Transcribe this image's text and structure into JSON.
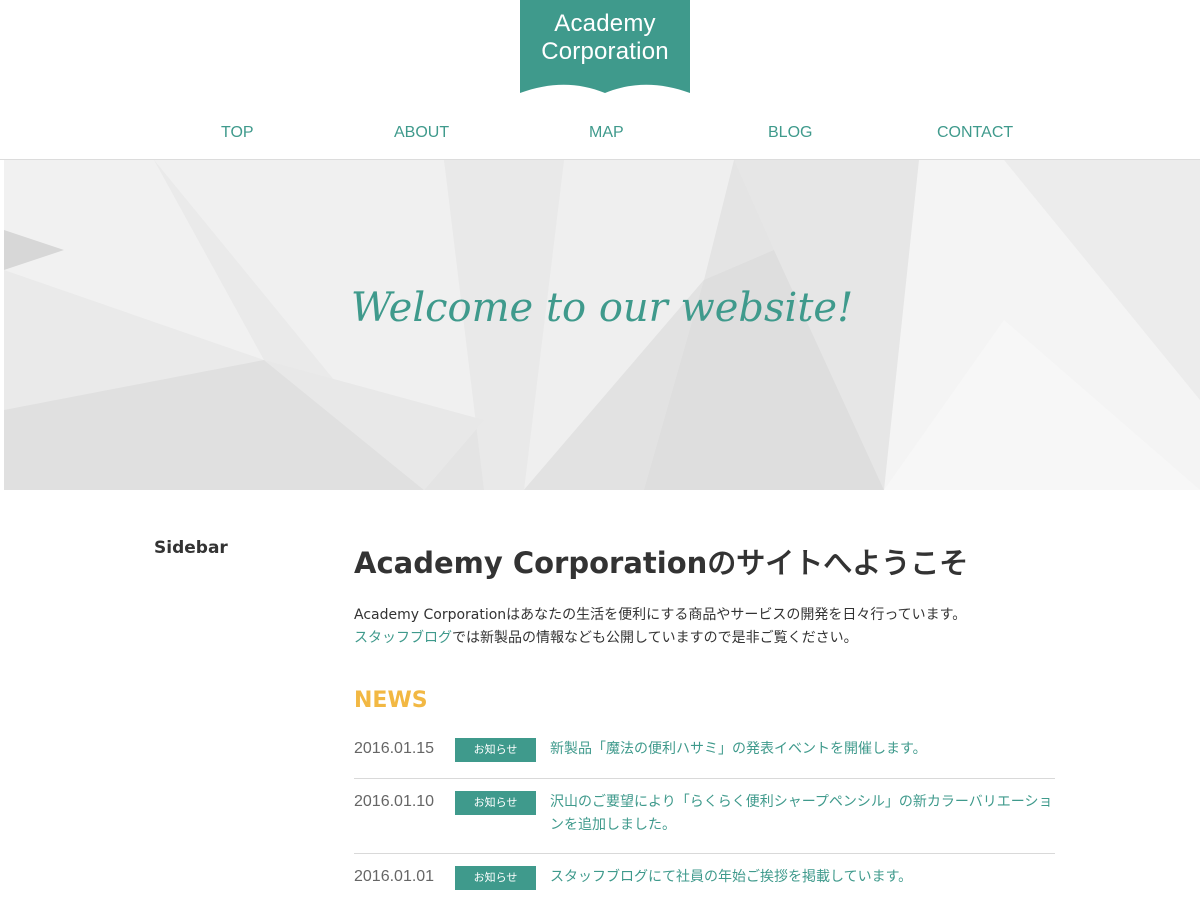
{
  "logo": {
    "line1": "Academy",
    "line2": "Corporation",
    "color": "#3f9a8c"
  },
  "nav": {
    "items": [
      {
        "label": "TOP"
      },
      {
        "label": "ABOUT"
      },
      {
        "label": "MAP"
      },
      {
        "label": "BLOG"
      },
      {
        "label": "CONTACT"
      }
    ]
  },
  "hero": {
    "headline": "Welcome to our website!"
  },
  "sidebar": {
    "title": "Sidebar"
  },
  "main": {
    "title": "Academy Corporationのサイトへようこそ",
    "intro_line1": "Academy Corporationはあなたの生活を便利にする商品やサービスの開発を日々行っています。",
    "intro_link": "スタッフブログ",
    "intro_line2_rest": "では新製品の情報なども公開していますので是非ご覧ください。"
  },
  "news": {
    "title": "NEWS",
    "items": [
      {
        "date": "2016.01.15",
        "badge": "お知らせ",
        "text": "新製品「魔法の便利ハサミ」の発表イベントを開催します。"
      },
      {
        "date": "2016.01.10",
        "badge": "お知らせ",
        "text": "沢山のご要望により「らくらく便利シャープペンシル」の新カラーバリエーションを追加しました。"
      },
      {
        "date": "2016.01.01",
        "badge": "お知らせ",
        "text": "スタッフブログにて社員の年始ご挨拶を掲載しています。"
      }
    ]
  },
  "colors": {
    "accent": "#3f9a8c",
    "news_heading": "#f2b843",
    "text": "#333333"
  }
}
